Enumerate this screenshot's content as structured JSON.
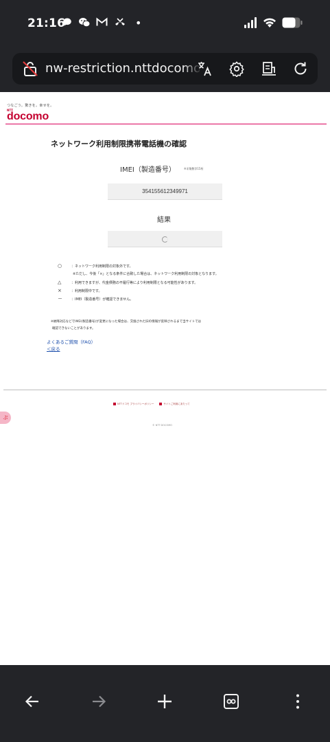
{
  "status_bar": {
    "time": "21:16",
    "dot": "•"
  },
  "url_bar": {
    "url": "nw-restriction.nttdocomo.co.jp"
  },
  "header": {
    "tagline": "つなごう。驚きを。幸せを。",
    "logo_ntt": "NTT",
    "logo_word": "docomo"
  },
  "main": {
    "title": "ネットワーク利用制限携帯電話機の確認",
    "imei_label": "IMEI（製造番号）",
    "imei_note": "※半角数字15桁",
    "imei_value": "354155612349971",
    "result_label": "結果",
    "legend": [
      {
        "symbol": "○",
        "text": "：ネットワーク利用制限の対象外です。"
      },
      {
        "symbol": "",
        "text": "※ただし、今後「×」となる条件に合致した場合は、ネットワーク利用制限の対象となります。"
      },
      {
        "symbol": "△",
        "text": "：利用できますが、代金債務の不履行等により利用制限となる可能性があります。"
      },
      {
        "symbol": "×",
        "text": "：利用制限中です。"
      },
      {
        "symbol": "－",
        "text": "：IMEI（製造番号）が確認できません。"
      }
    ],
    "notice_line1": "※故障対応などでIMEI(製造番号)が変更になった場合は、交換された旧の情報が反映されるまで当サイトでは",
    "notice_line2": "確認できないことがあります。",
    "faq_link": "よくあるご質問（FAQ）",
    "back_link": "＜戻る"
  },
  "footer": {
    "privacy": "NTTドコモ プライバシーポリシー",
    "site_usage": "サイトご利用にあたって",
    "copyright": "© NTT DOCOMO",
    "side_badge": "ぷ"
  },
  "colors": {
    "chrome_bg": "#232428",
    "docomo_red": "#c4002f",
    "link_blue": "#1a4dab"
  }
}
